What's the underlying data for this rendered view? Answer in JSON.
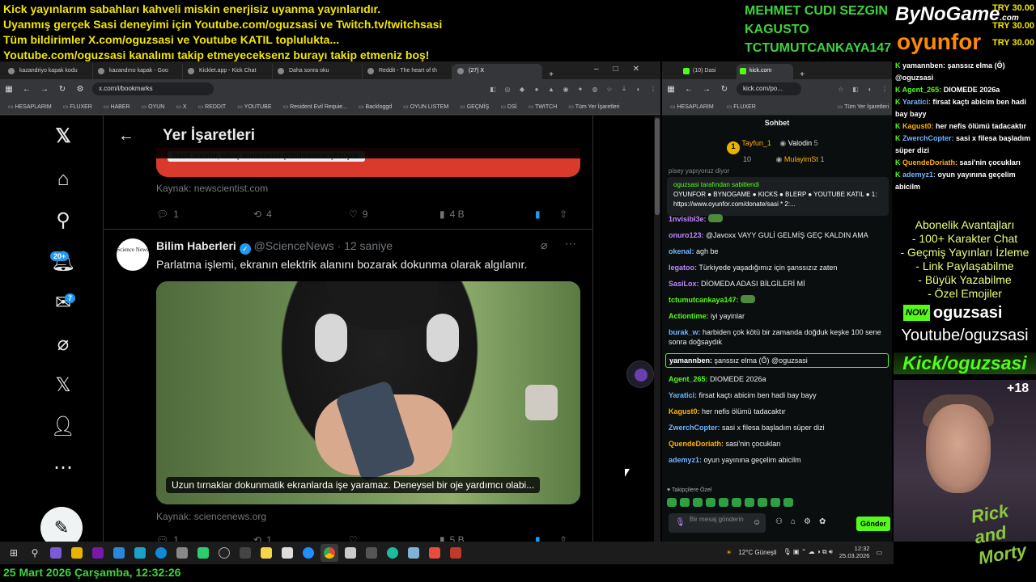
{
  "ticker": [
    "Kick yayınlarım sabahları kahveli miskin enerjisiz uyanma yayınlarıdır.",
    "Uyanmış gerçek Sasi deneyimi için Youtube.com/oguzsasi ve Twitch.tv/twitchsasi",
    "Tüm bildirimler X.com/oguzsasi ve Youtube KATIL topluluktа...",
    "Youtube.com/oguzsasi kanalımı takip etmeyeceksenz burayı takip etmeniz boş!"
  ],
  "sponsors": {
    "names": [
      "MEHMET CUDI SEZGIN",
      "KAGUSTO",
      "TCTUMUTCANKAYA147"
    ],
    "logo1": "ByNoGame",
    "logo1_suffix": ".com",
    "logo2": "oyunfor",
    "amounts": [
      "TRY 30.00",
      "TRY 30.00",
      "TRY 30.00"
    ]
  },
  "browser_left": {
    "tabs": [
      "kazandriyo kapak kodu",
      "kazandırıo kapak - Goo",
      "Kicklet.app - Kick Chat",
      "Daha sonra oku",
      "Reddit - The heart of th",
      "(27) X"
    ],
    "url": "x.com/i/bookmarks",
    "bookmarks": [
      "HESAPLARIM",
      "FLUXER",
      "HABER",
      "OYUN",
      "X",
      "REDDIT",
      "YOUTUBE",
      "Resident Evil Requie...",
      "Backloggd",
      "OYUN LISTEM",
      "GEÇMİŞ",
      "DSİ",
      "TWITCH",
      "Tüm Yer İşaretleri"
    ]
  },
  "x": {
    "page_title": "Yer İşaretleri",
    "badges": {
      "notifications": "20+",
      "messages": "7"
    },
    "prev_card_caption": "Basit sorular, bilinç sorununun çözülmesine çözüyor.",
    "prev_source": "Kaynak: newscientist.com",
    "prev_actions": {
      "replies": "1",
      "reposts": "4",
      "likes": "9",
      "views": "4 B"
    },
    "tweet": {
      "avatar_text": "Science News",
      "name": "Bilim Haberleri",
      "handle": "@ScienceNews",
      "time": "· 12 saniye",
      "text": "Parlatma işlemi, ekranın elektrik alanını bozarak dokunma olarak algılanır.",
      "caption": "Uzun tırnaklar dokunmatik ekranlarda işe yaramaz. Deneysel bir oje yardımcı olabi...",
      "source": "Kaynak: sciencenews.org",
      "actions": {
        "replies": "1",
        "reposts": "1",
        "likes": "",
        "views": "5 B"
      }
    }
  },
  "browser_right": {
    "tabs": [
      "(10) Dasi",
      "kick.com"
    ],
    "url": "kick.com/po...",
    "bookmarks": [
      "HESAPLARIM",
      "FLUXER",
      "Tüm Yer İşaretleri"
    ]
  },
  "chat": {
    "title": "Sohbet",
    "leaderboard": [
      "Tayfun_1",
      "10",
      "Valodin",
      "5",
      "MulayimSt",
      "1"
    ],
    "prev_line": "pisey yapıyoruz diyor",
    "pinned_by": "oguzsasi tarafından sabitlendi",
    "pinned_text": "OYUNFOR ● BYNOGAME ● KICKS ● BLERP ● YOUTUBE KATIL ● 1: https://www.oyunfor.com/donate/sasi * 2:...",
    "messages": [
      {
        "user": "1nvisibl3e:",
        "text": "",
        "color": "#c186ff",
        "emote": true
      },
      {
        "user": "onuro123:",
        "text": "@Javoxx VAYY GULİ GELMİŞ GEÇ KALDIN AMA",
        "color": "#c186ff"
      },
      {
        "user": "okenal:",
        "text": "agh be",
        "color": "#6fb7ff"
      },
      {
        "user": "legatoo:",
        "text": "Türkiyede yaşadığımız için şanssızız zaten",
        "color": "#c186ff"
      },
      {
        "user": "SasiLox:",
        "text": "DİOMEDA ADASI BİLGİLERİ Mİ",
        "color": "#c186ff"
      },
      {
        "user": "tctumutcankaya147:",
        "text": "",
        "color": "#53fc18",
        "emote": true
      },
      {
        "user": "Actiontime:",
        "text": "iyi yayinlar",
        "color": "#53fc18"
      },
      {
        "user": "burak_w:",
        "text": "harbiden çok kötü bir zamanda doğduk keşke 100 sene sonra doğsaydık",
        "color": "#6fb7ff"
      },
      {
        "user": "yamannben:",
        "text": "şanssız elma (ʘ̃) @oguzsasi",
        "color": "#ffffff",
        "highlight": true
      },
      {
        "user": "Agent_265:",
        "text": "DIOMEDE 2026a",
        "color": "#53fc18"
      },
      {
        "user": "Yaratici:",
        "text": "firsat kaçtı abicim ben hadi bay bayy",
        "color": "#6fb7ff"
      },
      {
        "user": "Kagust0:",
        "text": "her nefis ölümü tadacaktır",
        "color": "#ffb000"
      },
      {
        "user": "ZwerchCopter:",
        "text": "sasi x filesa başladım süper dizi",
        "color": "#6fb7ff"
      },
      {
        "user": "QuendeDoriath:",
        "text": "sasi'nin çocukları",
        "color": "#ffb000"
      },
      {
        "user": "ademyz1:",
        "text": "oyun yayınına geçelim abicilm",
        "color": "#6fb7ff"
      }
    ],
    "followers_label": "♥ Takipçilere Özel",
    "input_placeholder": "Bir mesaj gönderin",
    "send_label": "Gönder"
  },
  "overlay_chat": [
    {
      "user": "yamannben:",
      "text": "şanssız elma (ʘ̃) @oguzsasi",
      "color": "#ffffff"
    },
    {
      "user": "Agent_265:",
      "text": "DIOMEDE 2026a",
      "color": "#53fc18"
    },
    {
      "user": "Yaratici:",
      "text": "firsat kaçtı abicim ben hadi bay bayy",
      "color": "#6fb7ff"
    },
    {
      "user": "Kagust0:",
      "text": "her nefis ölümü tadacaktır",
      "color": "#ffb000"
    },
    {
      "user": "ZwerchCopter:",
      "text": "sasi x filesa başladım süper dizi",
      "color": "#6fb7ff"
    },
    {
      "user": "QuendeDoriath:",
      "text": "sasi'nin çocukları",
      "color": "#ffb000"
    },
    {
      "user": "ademyz1:",
      "text": "oyun yayınına geçelim abicilm",
      "color": "#6fb7ff"
    }
  ],
  "benefits": [
    "Abonelik Avantajları",
    "- 100+ Karakter Chat",
    "- Geçmiş Yayınları İzleme",
    "- Link Paylaşabilme",
    "- Büyük Yazabilme",
    "- Özel Emojiler"
  ],
  "branding": {
    "now": "NOW",
    "name": "oguzsasi",
    "youtube": "Youtube/oguzsasi",
    "kick": "Kick/oguzsasi",
    "age": "+18",
    "show": "Rick and Morty"
  },
  "taskbar": {
    "weather": "12°C Güneşli",
    "time": "12:32",
    "date": "25.03.2026"
  },
  "datebar": "25 Mart 2026 Çarşamba, 12:32:26"
}
